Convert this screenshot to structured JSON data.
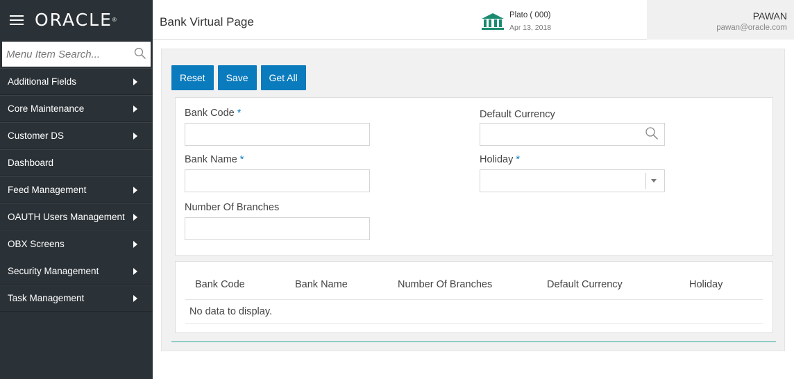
{
  "brand": {
    "logo": "ORACLE",
    "reg": "®"
  },
  "search": {
    "placeholder": "Menu Item Search..."
  },
  "sidebar": {
    "items": [
      {
        "label": "Additional Fields",
        "has_arrow": true
      },
      {
        "label": "Core Maintenance",
        "has_arrow": true
      },
      {
        "label": "Customer DS",
        "has_arrow": true
      },
      {
        "label": "Dashboard",
        "has_arrow": false
      },
      {
        "label": "Feed Management",
        "has_arrow": true
      },
      {
        "label": "OAUTH Users Management",
        "has_arrow": true
      },
      {
        "label": "OBX Screens",
        "has_arrow": true
      },
      {
        "label": "Security Management",
        "has_arrow": true
      },
      {
        "label": "Task Management",
        "has_arrow": true
      }
    ]
  },
  "header": {
    "title": "Bank Virtual Page",
    "entity": "Plato  ( 000)",
    "date": "Apr 13, 2018",
    "user_name": "PAWAN",
    "user_email": "pawan@oracle.com"
  },
  "toolbar": {
    "reset_label": "Reset",
    "save_label": "Save",
    "getall_label": "Get All"
  },
  "form": {
    "bank_code_label": "Bank Code",
    "bank_name_label": "Bank Name",
    "branches_label": "Number Of Branches",
    "currency_label": "Default Currency",
    "holiday_label": "Holiday",
    "required_mark": "*",
    "bank_code_value": "",
    "bank_name_value": "",
    "branches_value": "",
    "currency_value": "",
    "holiday_value": ""
  },
  "grid": {
    "columns": [
      "Bank Code",
      "Bank Name",
      "Number Of Branches",
      "Default Currency",
      "Holiday"
    ],
    "empty_message": "No data to display."
  },
  "colors": {
    "sidebar_bg": "#2b3237",
    "accent": "#0a7bbd",
    "teal": "#2aa39a"
  }
}
